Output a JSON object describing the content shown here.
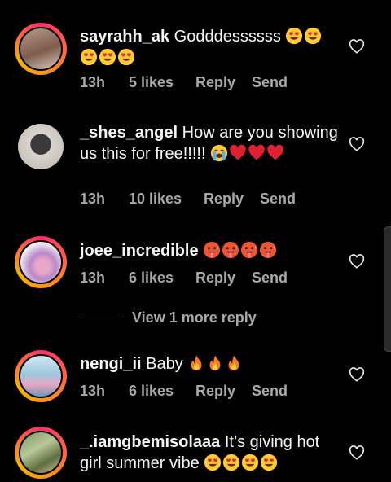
{
  "comments": [
    {
      "username": "sayrahh_ak",
      "text": "Godddessssss",
      "emoji": [
        "heart-eyes",
        "heart-eyes",
        "heart-eyes",
        "heart-eyes",
        "heart-eyes"
      ],
      "time": "13h",
      "likes": "5 likes",
      "reply": "Reply",
      "send": "Send"
    },
    {
      "username": "_shes_angel",
      "text": "How are you showing us this for free!!!!!",
      "emoji": [
        "crying-face",
        "red-heart",
        "red-heart",
        "red-heart"
      ],
      "time": "13h",
      "likes": "10 likes",
      "reply": "Reply",
      "send": "Send"
    },
    {
      "username": "joee_incredible",
      "text": "",
      "emoji": [
        "hot-face",
        "hot-face",
        "hot-face",
        "hot-face"
      ],
      "time": "13h",
      "likes": "6 likes",
      "reply": "Reply",
      "send": "Send"
    },
    {
      "username": "nengi_ii",
      "text": "Baby",
      "emoji": [
        "fire",
        "fire",
        "fire"
      ],
      "time": "13h",
      "likes": "6 likes",
      "reply": "Reply",
      "send": "Send"
    },
    {
      "username": "_.iamgbemisolaaa",
      "text": "It’s giving hot girl summer vibe",
      "emoji": [
        "heart-eyes",
        "heart-eyes",
        "heart-eyes",
        "heart-eyes"
      ]
    }
  ],
  "view_more_replies": "View 1 more reply",
  "colors": {
    "background": "#000000",
    "meta_gray": "#a8a8a8",
    "story_ring": "#ff2d6a"
  }
}
